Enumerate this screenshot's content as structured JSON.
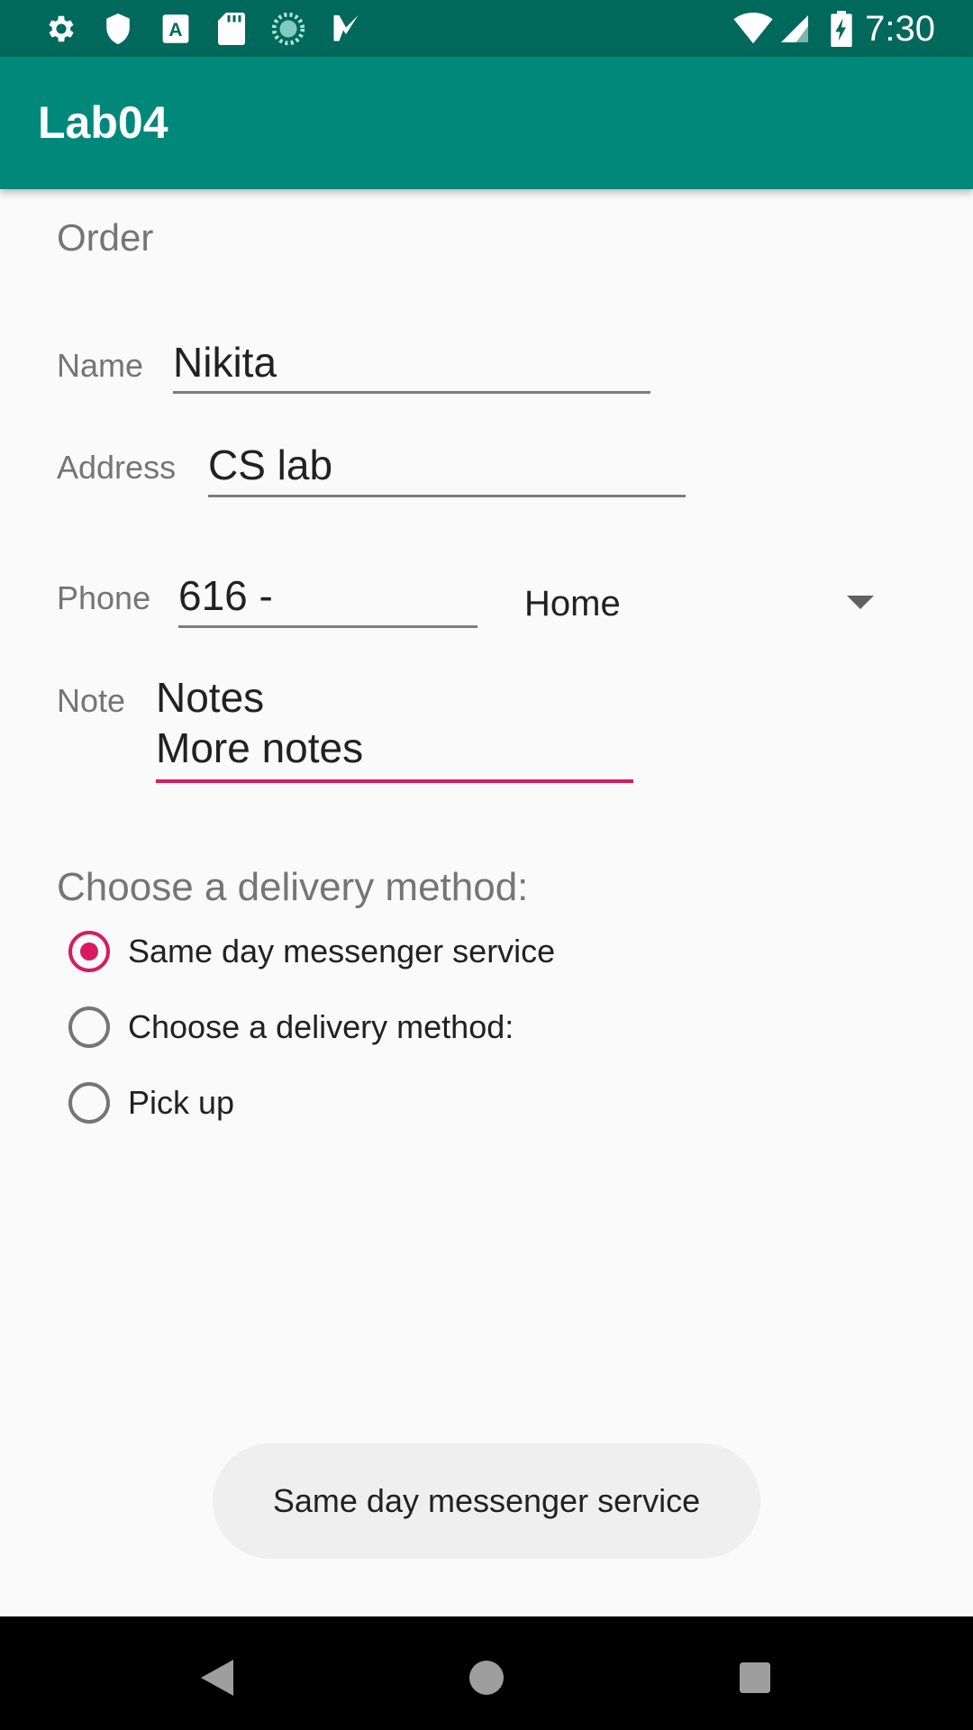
{
  "status_bar": {
    "time": "7:30",
    "left_icons": [
      "settings-icon",
      "shield-icon",
      "font-icon",
      "sd-card-icon",
      "sync-icon",
      "tasks-icon"
    ],
    "right_icons": [
      "wifi-icon",
      "cell-signal-icon",
      "battery-charging-icon"
    ]
  },
  "app_bar": {
    "title": "Lab04",
    "color": "#00897b"
  },
  "form": {
    "section_title": "Order",
    "name_label": "Name",
    "name_value": "Nikita",
    "address_label": "Address",
    "address_value": "CS lab",
    "phone_label": "Phone",
    "phone_value": "616 -",
    "phone_type_selected": "Home",
    "note_label": "Note",
    "note_value": "Notes\nMore notes",
    "accent_color": "#d81b60"
  },
  "delivery": {
    "title": "Choose a delivery method:",
    "options": [
      {
        "label": "Same day messenger service",
        "checked": true
      },
      {
        "label": "Choose a delivery method:",
        "checked": false
      },
      {
        "label": "Pick up",
        "checked": false
      }
    ]
  },
  "toast": {
    "text": "Same day messenger service"
  },
  "nav_bar": {
    "buttons": [
      "back-icon",
      "home-icon",
      "recents-icon"
    ]
  }
}
